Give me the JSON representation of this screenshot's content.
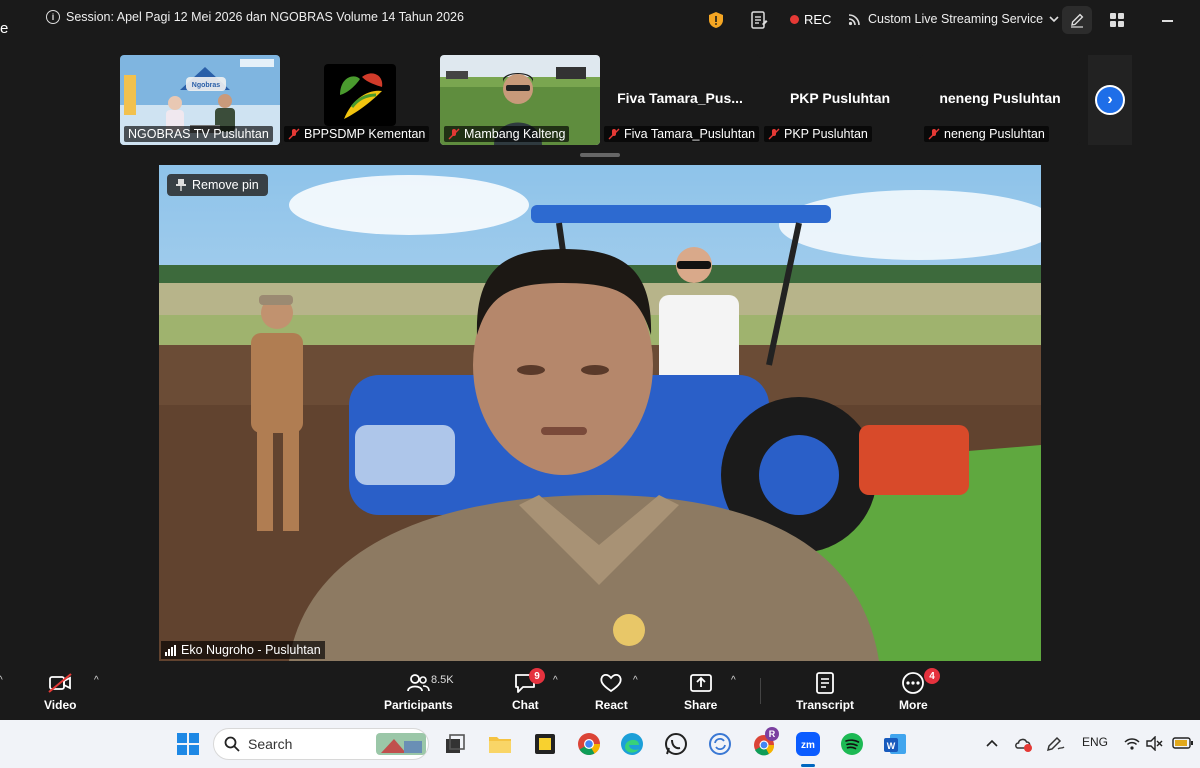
{
  "window": {
    "session_title": "Session: Apel Pagi 12 Mei 2026 dan NGOBRAS Volume 14 Tahun 2026",
    "edge_glyph": "e",
    "rec_label": "REC",
    "stream_label": "Custom Live Streaming Service",
    "icons": [
      "info-icon",
      "shield-icon",
      "meeting-notes-icon",
      "rec-dot-icon",
      "broadcast-icon",
      "chevron-down-icon",
      "pen-icon",
      "apps-grid-icon",
      "minimize-icon"
    ]
  },
  "thumbnails": [
    {
      "label": "NGOBRAS TV Pusluhtan",
      "muted": false,
      "type": "video"
    },
    {
      "label": "BPPSDMP Kementan",
      "muted": true,
      "type": "logo"
    },
    {
      "label": "Mambang Kalteng",
      "muted": true,
      "type": "video"
    },
    {
      "name": "Fiva  Tamara_Pus...",
      "label": "Fiva Tamara_Pusluhtan",
      "muted": true,
      "type": "name"
    },
    {
      "name": "PKP Pusluhtan",
      "label": "PKP Pusluhtan",
      "muted": true,
      "type": "name"
    },
    {
      "name": "neneng Pusluhtan",
      "label": "neneng Pusluhtan",
      "muted": true,
      "type": "name"
    }
  ],
  "main_video": {
    "remove_pin_label": "Remove pin",
    "speaker_label": "Eko Nugroho  - Pusluhtan"
  },
  "toolbar": {
    "video_label": "Video",
    "participants_label": "Participants",
    "participants_count": "8.5K",
    "chat_label": "Chat",
    "chat_badge": "9",
    "react_label": "React",
    "share_label": "Share",
    "transcript_label": "Transcript",
    "more_label": "More",
    "more_badge": "4"
  },
  "taskbar": {
    "search_placeholder": "Search",
    "language": "ENG",
    "chrome_profile_badge": "R",
    "apps": [
      "windows-start-icon",
      "task-view-icon",
      "file-explorer-icon",
      "sticky-notes-icon",
      "chrome-icon",
      "edge-icon",
      "whatsapp-icon",
      "sync-icon",
      "chrome-profile-icon",
      "zoom-icon",
      "spotify-icon",
      "word-icon"
    ]
  },
  "colors": {
    "accent_blue": "#1e6ee8",
    "rec_red": "#e53935",
    "badge_red": "#e5323e",
    "mute_red": "#e53935",
    "toolbar_bg": "#1a1a1a",
    "taskbar_bg": "#f1f3f8"
  }
}
